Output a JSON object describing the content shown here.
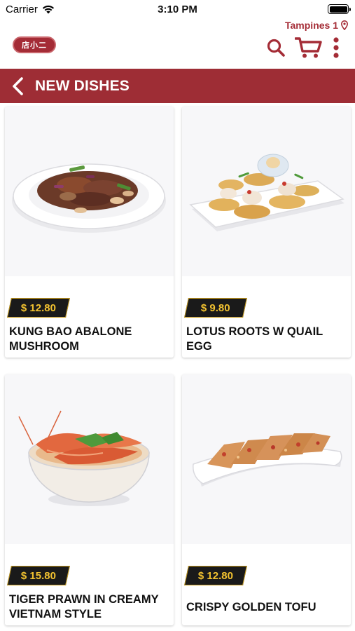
{
  "status_bar": {
    "carrier": "Carrier",
    "time": "3:10 PM"
  },
  "header": {
    "location": "Tampines 1",
    "logo_text": "店小二",
    "icons": [
      "search-icon",
      "cart-icon",
      "more-vertical-icon"
    ]
  },
  "title_bar": {
    "title": "NEW DISHES"
  },
  "colors": {
    "brand": "#9e2d35",
    "price_bg": "#1a1a1a",
    "price_text": "#f2c230"
  },
  "dishes": [
    {
      "price": "$ 12.80",
      "name": "KUNG BAO ABALONE MUSHROOM",
      "image": "stir-fry-plate-image"
    },
    {
      "price": "$ 9.80",
      "name": "LOTUS ROOTS W QUAIL EGG",
      "image": "lotus-chips-plate-image"
    },
    {
      "price": "$ 15.80",
      "name": "TIGER PRAWN IN CREAMY VIETNAM STYLE",
      "image": "prawn-bowl-image"
    },
    {
      "price": "$ 12.80",
      "name": "CRISPY GOLDEN TOFU",
      "image": "tofu-plate-image"
    }
  ]
}
